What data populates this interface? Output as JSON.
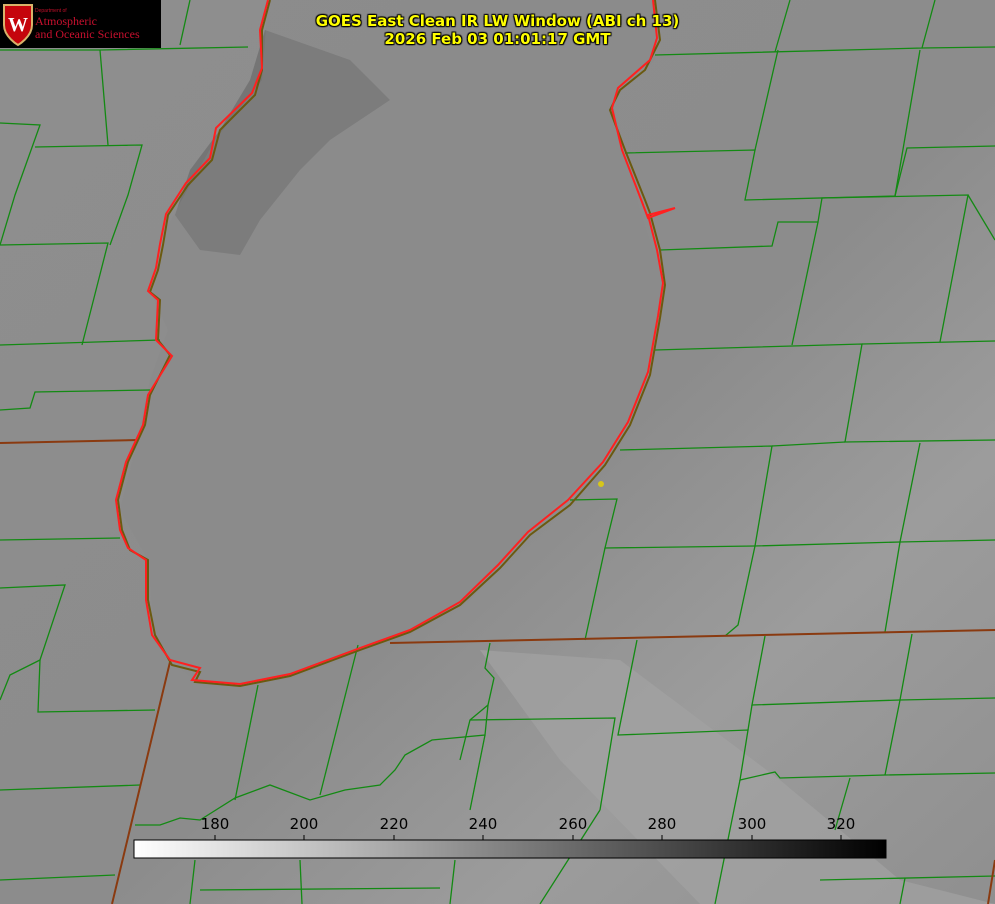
{
  "title": {
    "line1": "GOES East Clean IR LW Window (ABI ch 13)",
    "line2": "2026 Feb 03 01:01:17 GMT"
  },
  "logo": {
    "dept": "Department of",
    "line1": "Atmospheric",
    "line2": "and Oceanic Sciences",
    "badge": "W"
  },
  "colorbar": {
    "ticks": [
      "180",
      "200",
      "220",
      "240",
      "260",
      "280",
      "300",
      "320"
    ],
    "from_color": "#ffffff",
    "to_color": "#000000"
  },
  "colors": {
    "lake_outline": "#ff2020",
    "county_lines": "#138a13",
    "state_lines": "#8a3a10",
    "title_text": "#ffff00",
    "marker": "#d6c61a"
  }
}
